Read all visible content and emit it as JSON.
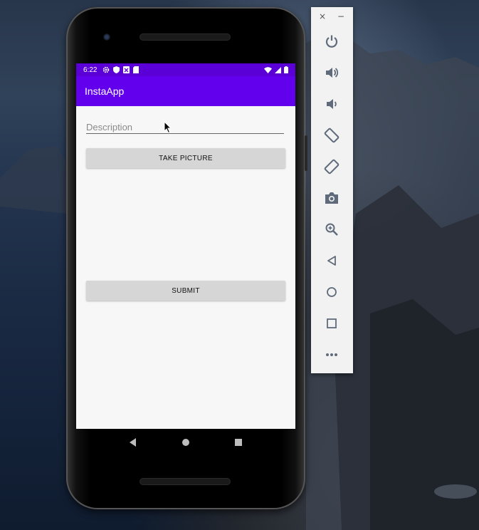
{
  "status_bar": {
    "time": "6:22"
  },
  "app": {
    "title": "InstaApp",
    "description_placeholder": "Description",
    "description_value": "",
    "take_picture_label": "TAKE PICTURE",
    "submit_label": "SUBMIT"
  },
  "colors": {
    "status_bar": "#5a00d6",
    "app_bar": "#6200ee",
    "button": "#d6d6d6",
    "screen_bg": "#f7f7f7"
  },
  "emulator_toolbar": {
    "close_label": "×",
    "minimize_label": "−",
    "buttons": [
      "power-icon",
      "volume-up-icon",
      "volume-down-icon",
      "rotate-left-icon",
      "rotate-right-icon",
      "camera-icon",
      "zoom-icon",
      "back-icon",
      "home-icon",
      "overview-icon",
      "more-icon"
    ]
  },
  "nav_bar": {
    "buttons": [
      "back-icon",
      "home-icon",
      "recents-icon"
    ]
  }
}
